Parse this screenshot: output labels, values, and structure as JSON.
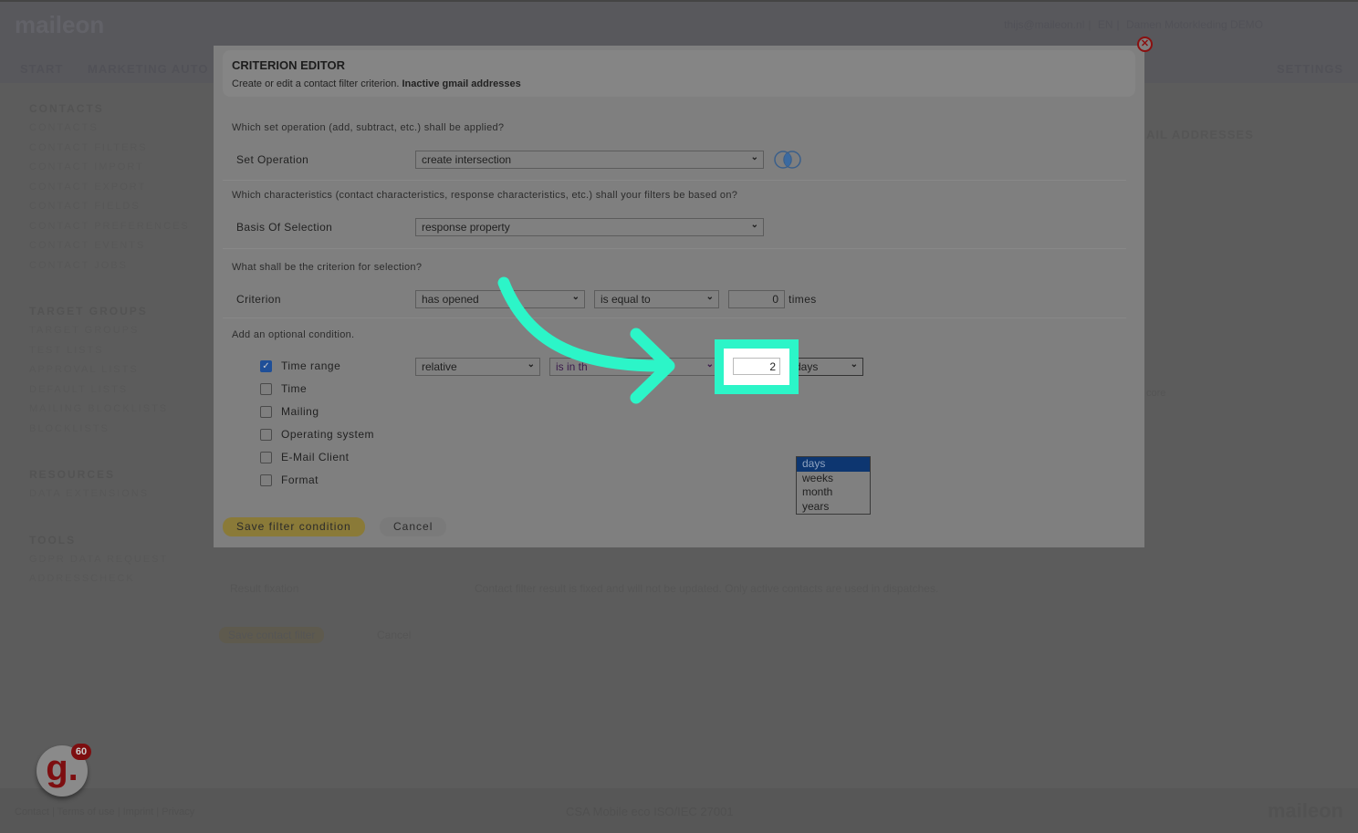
{
  "header": {
    "logo": "maileon",
    "user": "thijs@maileon.nl",
    "lang": "EN",
    "account": "Damen Motorkleding DEMO",
    "nav": [
      "START",
      "MARKETING AUTO",
      "SETTINGS"
    ]
  },
  "sidebar": [
    {
      "heading": "CONTACTS",
      "items": [
        "CONTACTS",
        "CONTACT FILTERS",
        "CONTACT IMPORT",
        "CONTACT EXPORT",
        "CONTACT FIELDS",
        "CONTACT PREFERENCES",
        "CONTACT EVENTS",
        "CONTACT JOBS"
      ]
    },
    {
      "heading": "TARGET GROUPS",
      "items": [
        "TARGET GROUPS",
        "TEST LISTS",
        "APPROVAL LISTS",
        "DEFAULT LISTS",
        "MAILING BLOCKLISTS",
        "BLOCKLISTS"
      ]
    },
    {
      "heading": "RESOURCES",
      "items": [
        "DATA EXTENSIONS"
      ]
    },
    {
      "heading": "TOOLS",
      "items": [
        "GDPR DATA REQUEST",
        "ADDRESSCHECK"
      ]
    }
  ],
  "background": {
    "page_title_fragment": "AIL ADDRESSES",
    "score_fragment": "core",
    "result_fixation_label": "Result fixation",
    "result_fixation_text": "Contact filter result is fixed and will not be updated. Only active contacts are used in dispatches.",
    "save_contact_filter": "Save contact filter",
    "cancel": "Cancel"
  },
  "footer": {
    "links": "Contact | Terms of use | Imprint | Privacy",
    "certs": "CSA  Mobile  eco  ISO/IEC 27001",
    "logo": "maileon"
  },
  "badge": {
    "letter": "g.",
    "count": "60"
  },
  "modal": {
    "title": "CRITERION EDITOR",
    "subtitle_prefix": "Create or edit a contact filter criterion. ",
    "subtitle_name": "Inactive gmail addresses",
    "q1": "Which set operation (add, subtract, etc.) shall be applied?",
    "set_operation_label": "Set Operation",
    "set_operation_value": "create intersection",
    "q2": "Which characteristics (contact characteristics, response characteristics, etc.) shall your filters be based on?",
    "basis_label": "Basis Of Selection",
    "basis_value": "response property",
    "q3": "What shall be the criterion for selection?",
    "criterion_label": "Criterion",
    "criterion_value": "has opened",
    "operator_value": "is equal to",
    "count_value": "0",
    "times": "times",
    "q4": "Add an optional condition.",
    "conditions": [
      {
        "label": "Time range",
        "checked": true
      },
      {
        "label": "Time",
        "checked": false
      },
      {
        "label": "Mailing",
        "checked": false
      },
      {
        "label": "Operating system",
        "checked": false
      },
      {
        "label": "E-Mail Client",
        "checked": false
      },
      {
        "label": "Format",
        "checked": false
      }
    ],
    "range_type": "relative",
    "range_operator": "is in th",
    "range_amount": "2",
    "range_unit": "days",
    "unit_options": [
      "days",
      "weeks",
      "month",
      "years"
    ],
    "save": "Save filter condition",
    "cancel": "Cancel"
  },
  "colors": {
    "highlight": "#2cf5c8",
    "save_button": "#8a7a38",
    "close_icon": "#8a1010"
  }
}
